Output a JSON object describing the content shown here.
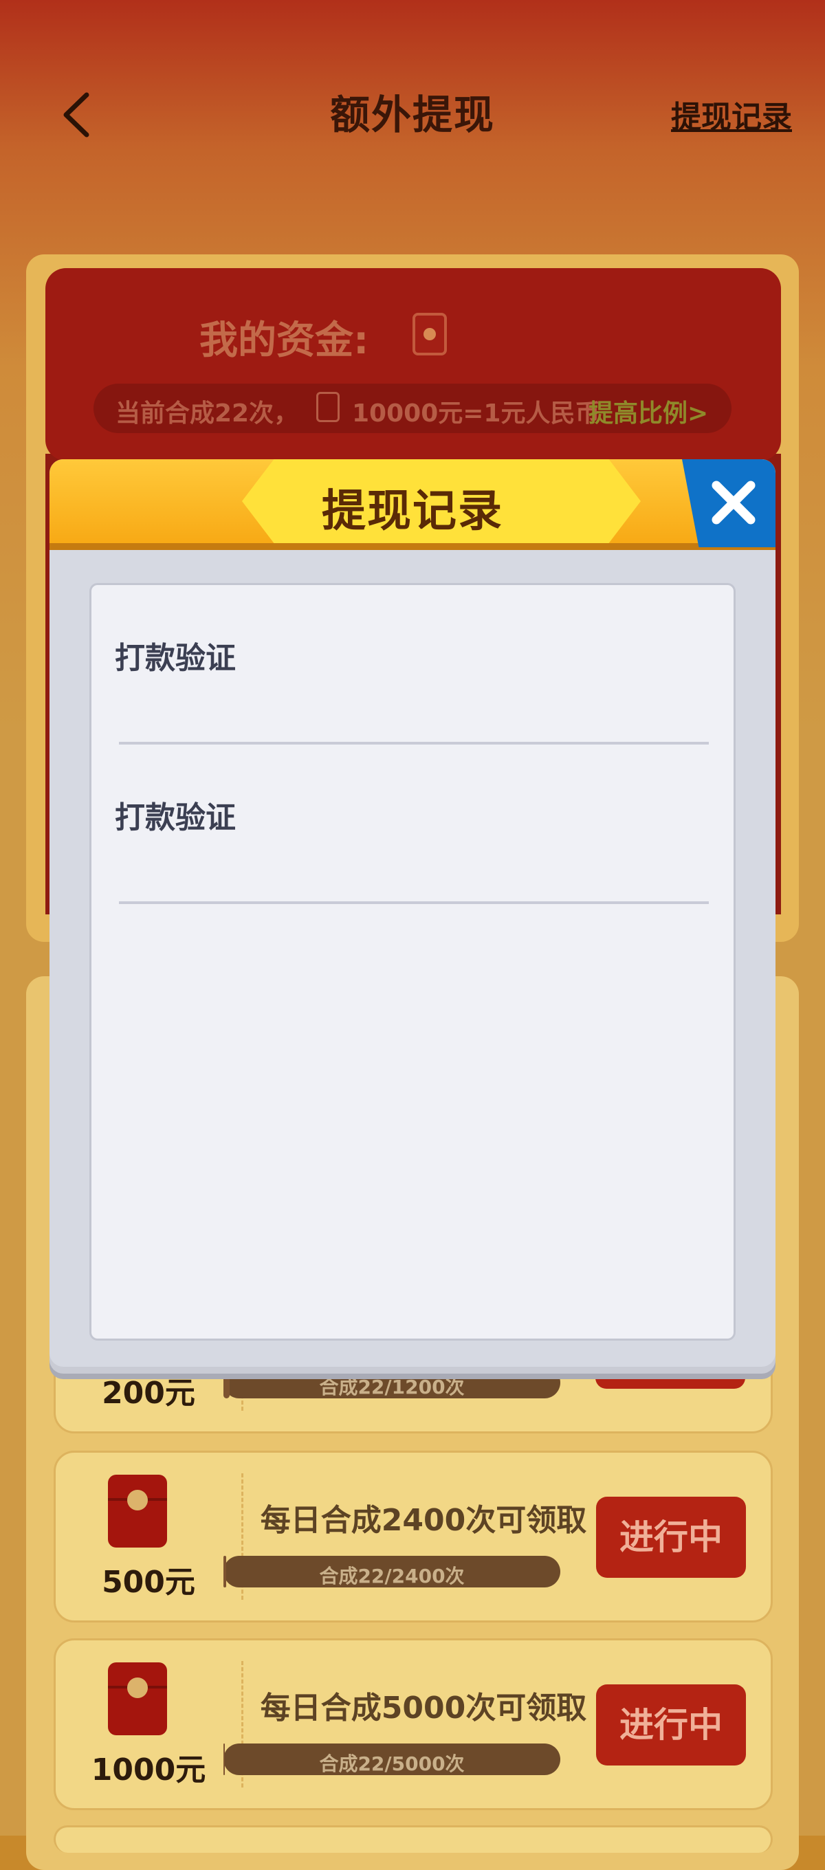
{
  "header": {
    "title": "额外提现",
    "record_link": "提现记录"
  },
  "funds": {
    "label": "我的资金:",
    "info_prefix": "当前合成22次，",
    "info_rate": "10000元=1元人民币",
    "info_link": "提高比例>"
  },
  "tasks": [
    {
      "amount": "200元",
      "title": "",
      "progress_text": "合成22/1200次",
      "progress": 0.018,
      "button": ""
    },
    {
      "amount": "500元",
      "title": "每日合成2400次可领取",
      "progress_text": "合成22/2400次",
      "progress": 0.009,
      "button": "进行中"
    },
    {
      "amount": "1000元",
      "title": "每日合成5000次可领取",
      "progress_text": "合成22/5000次",
      "progress": 0.004,
      "button": "进行中"
    }
  ],
  "modal": {
    "title": "提现记录",
    "records": [
      {
        "label": "打款验证"
      },
      {
        "label": "打款验证"
      }
    ]
  },
  "icons": {
    "back": "chevron-left-icon",
    "close": "close-icon",
    "red_packet": "red-packet-icon"
  },
  "colors": {
    "modal_header": "#f7a712",
    "close_button": "#0f72c8",
    "task_button": "#b42313"
  }
}
